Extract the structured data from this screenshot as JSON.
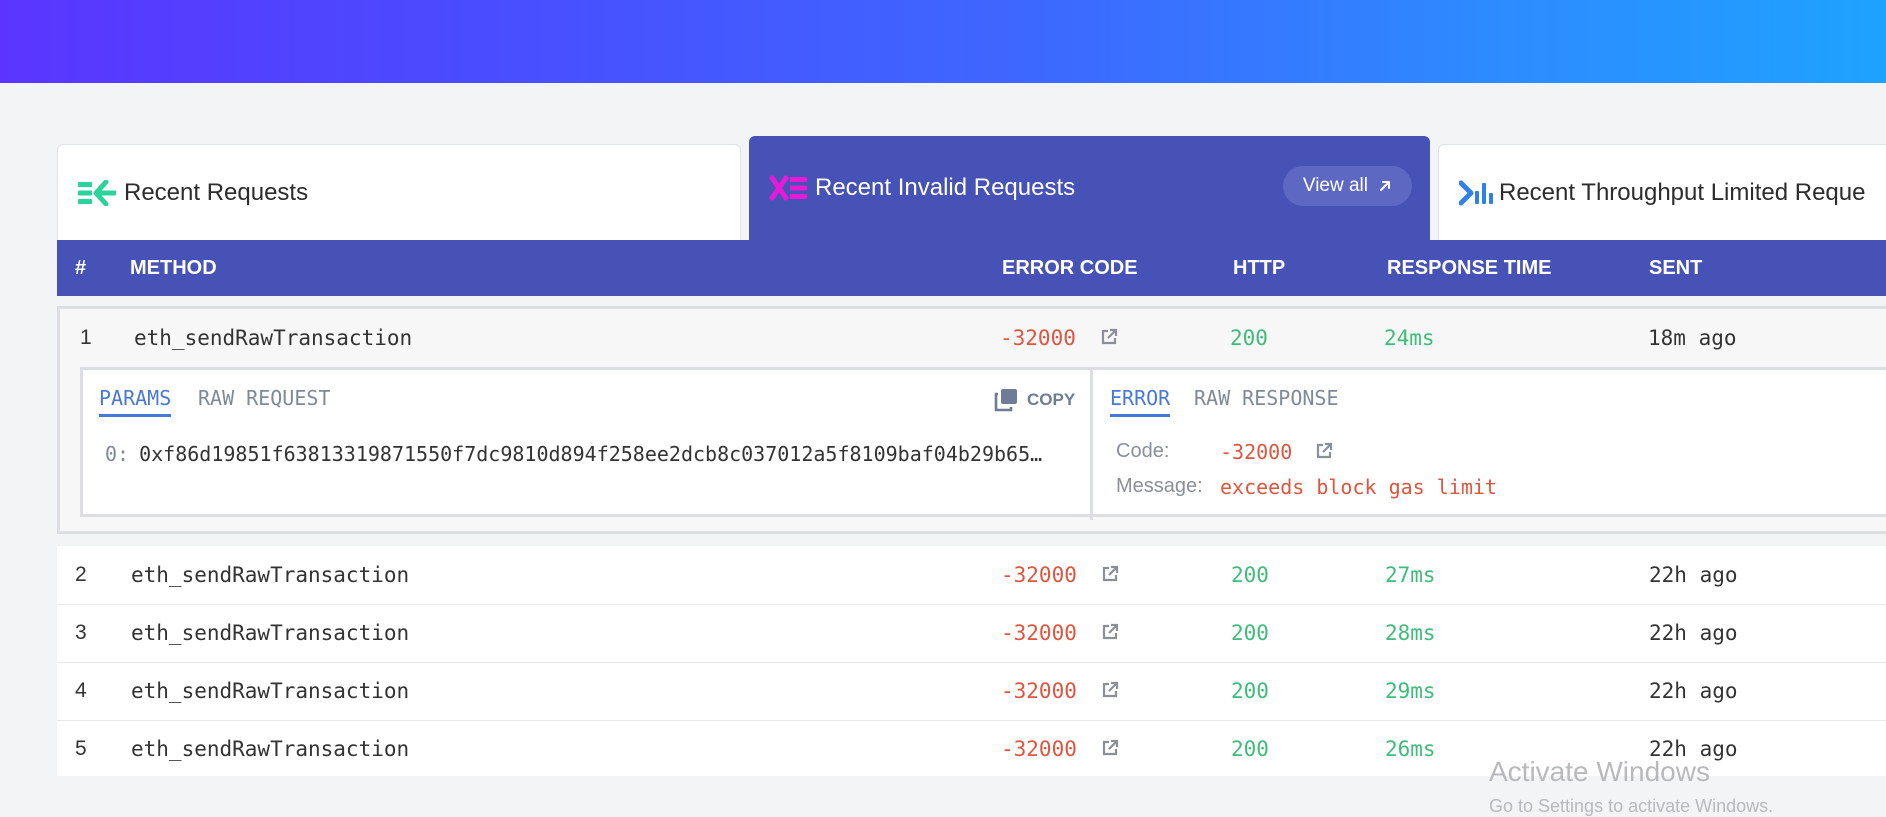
{
  "tabs": [
    {
      "label": "Recent Requests",
      "icon": "incoming-arrows-icon",
      "active": false
    },
    {
      "label": "Recent Invalid Requests",
      "icon": "invalid-x-icon",
      "active": true
    },
    {
      "label": "Recent Throughput Limited Reque",
      "icon": "throughput-bars-icon",
      "active": false
    }
  ],
  "view_all_label": "View all",
  "table": {
    "headers": {
      "num": "#",
      "method": "METHOD",
      "error_code": "ERROR CODE",
      "http": "HTTP",
      "response_time": "RESPONSE TIME",
      "sent": "SENT"
    },
    "rows": [
      {
        "num": "1",
        "method": "eth_sendRawTransaction",
        "error_code": "-32000",
        "http": "200",
        "response_time": "24ms",
        "sent": "18m ago"
      },
      {
        "num": "2",
        "method": "eth_sendRawTransaction",
        "error_code": "-32000",
        "http": "200",
        "response_time": "27ms",
        "sent": "22h ago"
      },
      {
        "num": "3",
        "method": "eth_sendRawTransaction",
        "error_code": "-32000",
        "http": "200",
        "response_time": "28ms",
        "sent": "22h ago"
      },
      {
        "num": "4",
        "method": "eth_sendRawTransaction",
        "error_code": "-32000",
        "http": "200",
        "response_time": "29ms",
        "sent": "22h ago"
      },
      {
        "num": "5",
        "method": "eth_sendRawTransaction",
        "error_code": "-32000",
        "http": "200",
        "response_time": "26ms",
        "sent": "22h ago"
      }
    ]
  },
  "detail": {
    "left_tabs": [
      "PARAMS",
      "RAW REQUEST"
    ],
    "copy_label": "COPY",
    "param_index": "0:",
    "param_value": "0xf86d19851f63813319871550f7dc9810d894f258ee2dcb8c037012a5f8109baf04b29b65…",
    "right_tabs": [
      "ERROR",
      "RAW RESPONSE"
    ],
    "code_label": "Code:",
    "code_value": "-32000",
    "message_label": "Message:",
    "message_value": "exceeds block gas limit"
  },
  "watermark": {
    "line1": "Activate Windows",
    "line2": "Go to Settings to activate Windows."
  },
  "colors": {
    "header_bg": "#4652b5",
    "error_red": "#e0553f",
    "success_green": "#3ebd7a",
    "link_blue": "#4a78d9"
  }
}
